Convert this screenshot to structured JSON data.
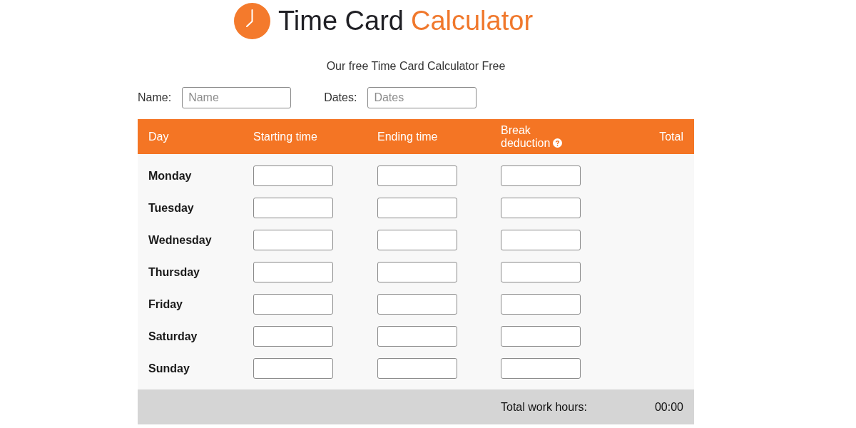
{
  "logo": {
    "title": "Time Card",
    "accent": "Calculator"
  },
  "subtitle": "Our free Time Card Calculator Free",
  "fields": [
    {
      "label": "Name:",
      "placeholder": "Name"
    },
    {
      "label": "Dates:",
      "placeholder": "Dates"
    }
  ],
  "table": {
    "columns": [
      {
        "label": "Day",
        "kind": "day",
        "help": false
      },
      {
        "label": "Starting time",
        "kind": "input",
        "help": false
      },
      {
        "label": "Ending time",
        "kind": "input",
        "help": false
      },
      {
        "label": "Break deduction",
        "kind": "input",
        "help": true
      },
      {
        "label": "Total",
        "kind": "total",
        "help": false
      }
    ],
    "rows": [
      {
        "day": "Monday"
      },
      {
        "day": "Tuesday"
      },
      {
        "day": "Wednesday"
      },
      {
        "day": "Thursday"
      },
      {
        "day": "Friday"
      },
      {
        "day": "Saturday"
      },
      {
        "day": "Sunday"
      }
    ],
    "footer": {
      "label": "Total work hours:",
      "value": "00:00"
    }
  }
}
